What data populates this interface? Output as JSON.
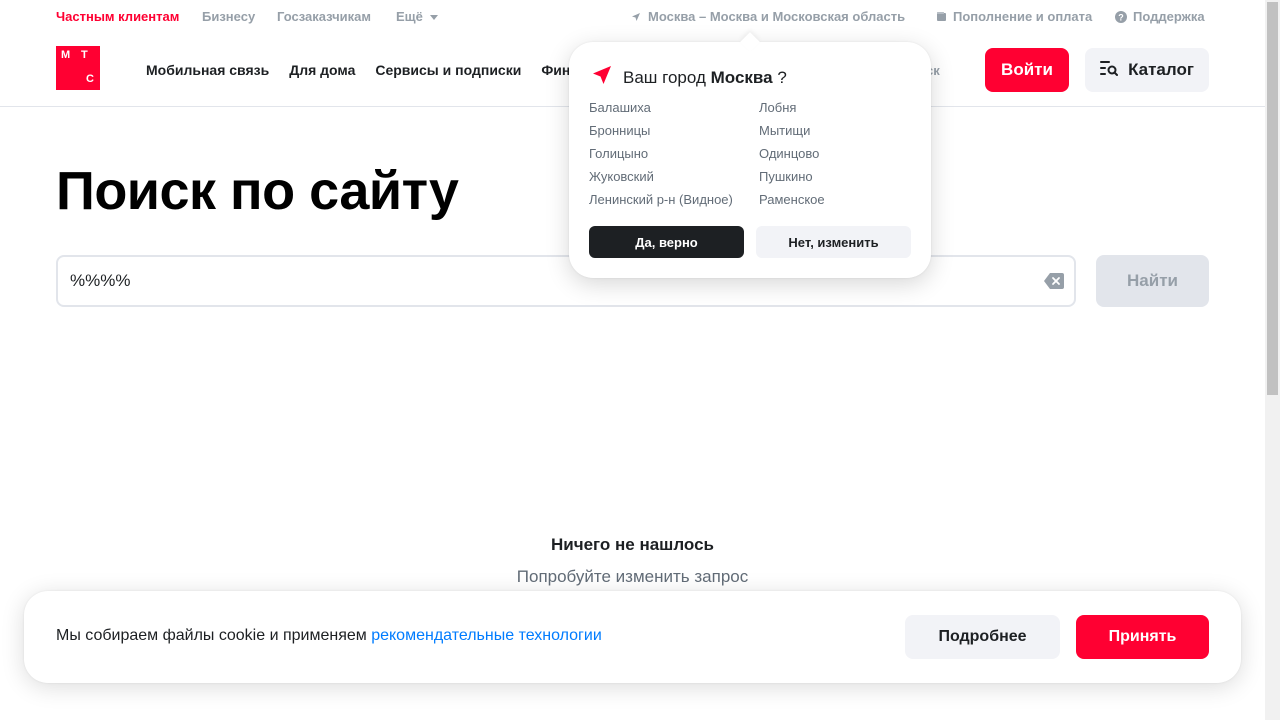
{
  "topbar": {
    "segments": [
      "Частным клиентам",
      "Бизнесу",
      "Госзаказчикам",
      "Ещё"
    ],
    "region": "Москва – Москва и Московская область",
    "topup": "Пополнение и оплата",
    "support": "Поддержка"
  },
  "header": {
    "logo_letters": [
      "М",
      "Т",
      "С"
    ],
    "nav": [
      "Мобильная связь",
      "Для дома",
      "Сервисы и подписки",
      "Финансы"
    ],
    "search_hint": "иск",
    "login_label": "Войти",
    "catalog_label": "Каталог"
  },
  "main": {
    "title": "Поиск по сайту",
    "search_value": "%%%%",
    "find_label": "Найти",
    "empty_title": "Ничего не нашлось",
    "empty_sub": "Попробуйте изменить запрос"
  },
  "city_popup": {
    "question_prefix": "Ваш город",
    "city": "Москва",
    "question_suffix": "?",
    "cities_left": [
      "Балашиха",
      "Бронницы",
      "Голицыно",
      "Жуковский",
      "Ленинский р-н (Видное)"
    ],
    "cities_right": [
      "Лобня",
      "Мытищи",
      "Одинцово",
      "Пушкино",
      "Раменское"
    ],
    "yes_label": "Да, верно",
    "no_label": "Нет, изменить"
  },
  "cookie": {
    "text": "Мы собираем файлы cookie и применяем",
    "link": "рекомендательные технологии",
    "more_label": "Подробнее",
    "accept_label": "Принять"
  },
  "colors": {
    "brand": "#ff0032",
    "dark": "#1d2023",
    "muted": "#969fa8",
    "link": "#007cff"
  }
}
